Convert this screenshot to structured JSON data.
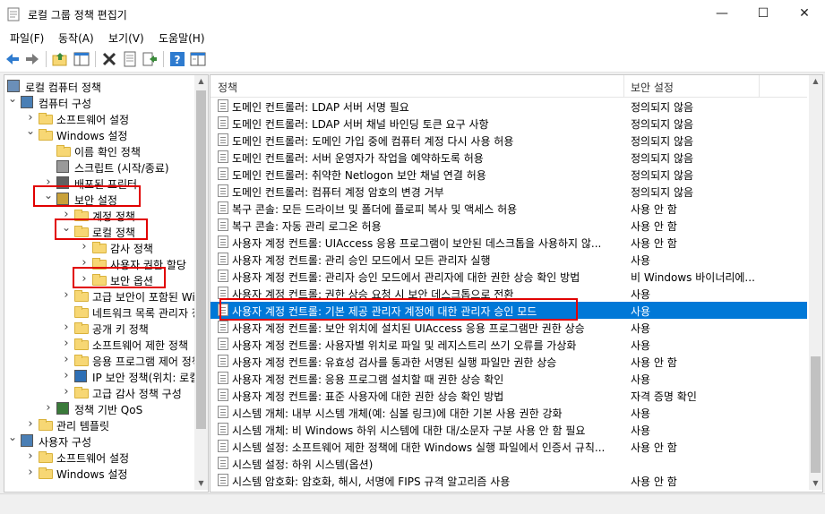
{
  "window": {
    "title": "로컬 그룹 정책 편집기",
    "minimize": "—",
    "maximize": "☐",
    "close": "✕"
  },
  "menu": [
    "파일(F)",
    "동작(A)",
    "보기(V)",
    "도움말(H)"
  ],
  "toolbar": {
    "icons": [
      "back-icon",
      "forward-icon",
      "up-folder-icon",
      "show-hide-tree-icon",
      "delete-icon",
      "properties-icon",
      "export-icon",
      "help-icon",
      "extended-view-icon"
    ]
  },
  "tree": {
    "items": [
      {
        "label": "로컬 컴퓨터 정책",
        "level": 0,
        "expander": "",
        "icon": "computer-policy-icon"
      },
      {
        "label": "컴퓨터 구성",
        "level": 1,
        "expander": "v",
        "icon": "computer-icon"
      },
      {
        "label": "소프트웨어 설정",
        "level": 2,
        "expander": ">",
        "icon": "folder-icon"
      },
      {
        "label": "Windows 설정",
        "level": 2,
        "expander": "v",
        "icon": "folder-icon"
      },
      {
        "label": "이름 확인 정책",
        "level": 3,
        "expander": "",
        "icon": "folder-icon"
      },
      {
        "label": "스크립트 (시작/종료)",
        "level": 3,
        "expander": "",
        "icon": "script-icon"
      },
      {
        "label": "배포된 프린터",
        "level": 3,
        "expander": ">",
        "icon": "printer-icon"
      },
      {
        "label": "보안 설정",
        "level": 3,
        "expander": "v",
        "icon": "security-settings-icon"
      },
      {
        "label": "계정 정책",
        "level": 4,
        "expander": ">",
        "icon": "folder-icon"
      },
      {
        "label": "로컬 정책",
        "level": 4,
        "expander": "v",
        "icon": "folder-icon"
      },
      {
        "label": "감사 정책",
        "level": 5,
        "expander": ">",
        "icon": "folder-icon"
      },
      {
        "label": "사용자 권한 할당",
        "level": 5,
        "expander": ">",
        "icon": "folder-icon"
      },
      {
        "label": "보안 옵션",
        "level": 5,
        "expander": ">",
        "icon": "folder-icon"
      },
      {
        "label": "고급 보안이 포함된 Windows Defender 방화벽",
        "level": 4,
        "expander": ">",
        "icon": "folder-icon"
      },
      {
        "label": "네트워크 목록 관리자 정책",
        "level": 4,
        "expander": "",
        "icon": "folder-icon"
      },
      {
        "label": "공개 키 정책",
        "level": 4,
        "expander": ">",
        "icon": "folder-icon"
      },
      {
        "label": "소프트웨어 제한 정책",
        "level": 4,
        "expander": ">",
        "icon": "folder-icon"
      },
      {
        "label": "응용 프로그램 제어 정책",
        "level": 4,
        "expander": ">",
        "icon": "folder-icon"
      },
      {
        "label": "IP 보안 정책(위치: 로컬 컴퓨터)",
        "level": 4,
        "expander": ">",
        "icon": "ip-security-icon"
      },
      {
        "label": "고급 감사 정책 구성",
        "level": 4,
        "expander": ">",
        "icon": "folder-icon"
      },
      {
        "label": "정책 기반 QoS",
        "level": 3,
        "expander": ">",
        "icon": "qos-chart-icon"
      },
      {
        "label": "관리 템플릿",
        "level": 2,
        "expander": ">",
        "icon": "folder-icon"
      },
      {
        "label": "사용자 구성",
        "level": 1,
        "expander": "v",
        "icon": "user-icon"
      },
      {
        "label": "소프트웨어 설정",
        "level": 2,
        "expander": ">",
        "icon": "folder-icon"
      },
      {
        "label": "Windows 설정",
        "level": 2,
        "expander": ">",
        "icon": "folder-icon"
      }
    ]
  },
  "list": {
    "columns": {
      "policy": "정책",
      "setting": "보안 설정"
    },
    "rows": [
      {
        "policy": "도메인 컨트롤러: LDAP 서버 서명 필요",
        "setting": "정의되지 않음"
      },
      {
        "policy": "도메인 컨트롤러: LDAP 서버 채널 바인딩 토큰 요구 사항",
        "setting": "정의되지 않음"
      },
      {
        "policy": "도메인 컨트롤러: 도메인 가입 중에 컴퓨터 계정 다시 사용 허용",
        "setting": "정의되지 않음"
      },
      {
        "policy": "도메인 컨트롤러: 서버 운영자가 작업을 예약하도록 허용",
        "setting": "정의되지 않음"
      },
      {
        "policy": "도메인 컨트롤러: 취약한 Netlogon 보안 채널 연결 허용",
        "setting": "정의되지 않음"
      },
      {
        "policy": "도메인 컨트롤러: 컴퓨터 계정 암호의 변경 거부",
        "setting": "정의되지 않음"
      },
      {
        "policy": "복구 콘솔: 모든 드라이브 및 폴더에 플로피 복사 및 액세스 허용",
        "setting": "사용 안 함"
      },
      {
        "policy": "복구 콘솔: 자동 관리 로그온 허용",
        "setting": "사용 안 함"
      },
      {
        "policy": "사용자 계정 컨트롤: UIAccess 응용 프로그램이 보안된 데스크톱을 사용하지 않...",
        "setting": "사용 안 함"
      },
      {
        "policy": "사용자 계정 컨트롤: 관리 승인 모드에서 모든 관리자 실행",
        "setting": "사용"
      },
      {
        "policy": "사용자 계정 컨트롤: 관리자 승인 모드에서 관리자에 대한 권한 상승 확인 방법",
        "setting": "비 Windows 바이너리에..."
      },
      {
        "policy": "사용자 계정 컨트롤: 권한 상승 요청 시 보안 데스크톱으로 전환",
        "setting": "사용"
      },
      {
        "policy": "사용자 계정 컨트롤: 기본 제공 관리자 계정에 대한 관리자 승인 모드",
        "setting": "사용"
      },
      {
        "policy": "사용자 계정 컨트롤: 보안 위치에 설치된 UIAccess 응용 프로그램만 권한 상승",
        "setting": "사용"
      },
      {
        "policy": "사용자 계정 컨트롤: 사용자별 위치로 파일 및 레지스트리 쓰기 오류를 가상화",
        "setting": "사용"
      },
      {
        "policy": "사용자 계정 컨트롤: 유효성 검사를 통과한 서명된 실행 파일만 권한 상승",
        "setting": "사용 안 함"
      },
      {
        "policy": "사용자 계정 컨트롤: 응용 프로그램 설치할 때 권한 상승 확인",
        "setting": "사용"
      },
      {
        "policy": "사용자 계정 컨트롤: 표준 사용자에 대한 권한 상승 확인 방법",
        "setting": "자격 증명 확인"
      },
      {
        "policy": "시스템 개체: 내부 시스템 개체(예: 심볼 링크)에 대한 기본 사용 권한 강화",
        "setting": "사용"
      },
      {
        "policy": "시스템 개체: 비 Windows 하위 시스템에 대한 대/소문자 구분 사용 안 함 필요",
        "setting": "사용"
      },
      {
        "policy": "시스템 설정: 소프트웨어 제한 정책에 대한 Windows 실행 파일에서 인증서 규칙...",
        "setting": "사용 안 함"
      },
      {
        "policy": "시스템 설정: 하위 시스템(옵션)",
        "setting": ""
      },
      {
        "policy": "시스템 암호화: 암호화, 해시, 서명에 FIPS 규격 알고리즘 사용",
        "setting": "사용 안 함"
      }
    ],
    "selected_index": 12
  },
  "colors": {
    "selection": "#0078d7",
    "highlight_box": "#e10000"
  }
}
